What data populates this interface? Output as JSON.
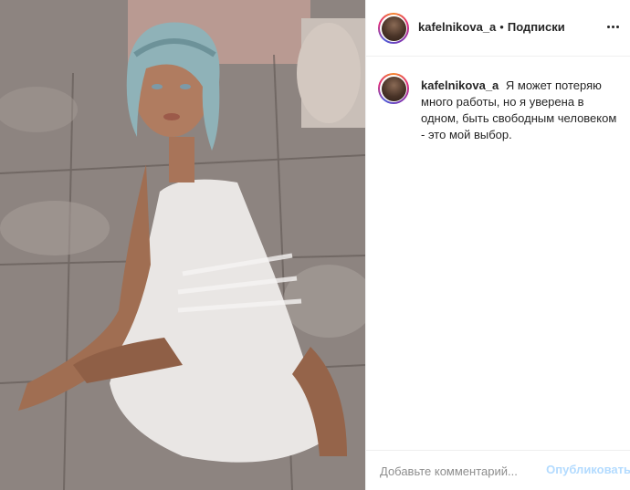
{
  "post": {
    "image_icon": "photo-of-woman-in-white-dress"
  },
  "header": {
    "username": "kafelnikova_a",
    "separator": "•",
    "follow_label": "Подписки"
  },
  "caption": {
    "username": "kafelnikova_a",
    "text": "Я может потеряю много работы, но я уверена в одном, быть свободным человеком - это мой выбор."
  },
  "comment_box": {
    "placeholder": "Добавьте комментарий...",
    "publish_label": "Опубликовать"
  },
  "colors": {
    "link_disabled": "#b3dbff",
    "text": "#262626",
    "muted": "#8e8e8e",
    "border": "#efefef"
  }
}
